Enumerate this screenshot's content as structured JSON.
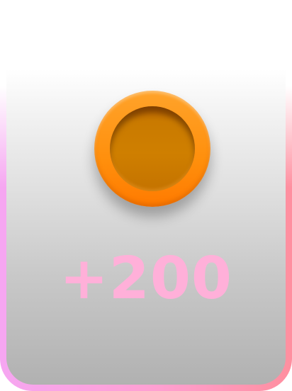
{
  "reward": {
    "amount_label": "+200",
    "icon": "coin-icon"
  },
  "colors": {
    "coin_outer": "#ff8f0c",
    "coin_inner": "#cf7f00",
    "reward_text": "#ffb0d9",
    "border_left": "#f6a6f2",
    "border_right": "#ff8f9f"
  }
}
